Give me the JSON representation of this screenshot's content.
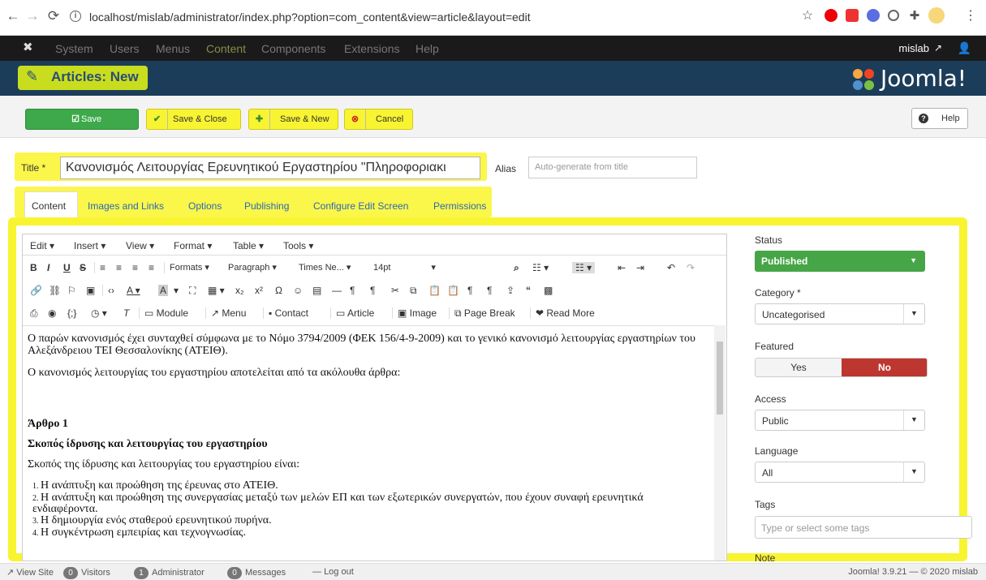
{
  "browser": {
    "url": "localhost/mislab/administrator/index.php?option=com_content&view=article&layout=edit"
  },
  "topmenu": {
    "items": [
      "System",
      "Users",
      "Menus",
      "Content",
      "Components",
      "Extensions",
      "Help"
    ],
    "user": "mislab"
  },
  "header": {
    "title": "Articles: New",
    "brand": "Joomla!"
  },
  "toolbar": {
    "save": "Save",
    "save_close": "Save & Close",
    "save_new": "Save & New",
    "cancel": "Cancel",
    "help": "Help"
  },
  "form": {
    "title_label": "Title *",
    "title_value": "Κανονισμός Λειτουργίας Ερευνητικού Εργαστηρίου \"Πληροφοριακι",
    "alias_label": "Alias",
    "alias_placeholder": "Auto-generate from title"
  },
  "tabs": [
    "Content",
    "Images and Links",
    "Options",
    "Publishing",
    "Configure Edit Screen",
    "Permissions"
  ],
  "editor": {
    "menus": [
      "Edit ▾",
      "Insert ▾",
      "View ▾",
      "Format ▾",
      "Table ▾",
      "Tools ▾"
    ],
    "formats": "Formats ▾",
    "paragraph": "Paragraph",
    "font": "Times Ne...",
    "size": "14pt",
    "row3": {
      "module": "Module",
      "menu": "Menu",
      "contact": "Contact",
      "article": "Article",
      "image": "Image",
      "pagebreak": "Page Break",
      "readmore": "Read More"
    },
    "content": {
      "p1": "Ο παρών κανονισμός έχει συνταχθεί σύμφωνα με το Νόμο 3794/2009 (ΦΕΚ 156/4-9-2009) και το γενικό κανονισμό λειτουργίας εργαστηρίων του Αλεξάνδρειου ΤΕΙ Θεσσαλονίκης (ΑΤΕΙΘ).",
      "p2": "Ο κανονισμός λειτουργίας του εργαστηρίου αποτελείται από τα ακόλουθα άρθρα:",
      "h1": "Άρθρο 1",
      "h2": "Σκοπός ίδρυσης και λειτουργίας του εργαστηρίου",
      "p3": "Σκοπός της ίδρυσης και λειτουργίας του εργαστηρίου είναι:",
      "list": [
        "Η ανάπτυξη και προώθηση της έρευνας στο ΑΤΕΙΘ.",
        "Η ανάπτυξη και προώθηση της συνεργασίας μεταξύ των μελών ΕΠ και των εξωτερικών συνεργατών, που έχουν συναφή ερευνητικά ενδιαφέροντα.",
        "Η δημιουργία ενός σταθερού ερευνητικού πυρήνα.",
        "Η συγκέντρωση εμπειρίας και τεχνογνωσίας."
      ]
    }
  },
  "sidebar": {
    "status_label": "Status",
    "status_value": "Published",
    "category_label": "Category *",
    "category_value": "Uncategorised",
    "featured_label": "Featured",
    "featured_yes": "Yes",
    "featured_no": "No",
    "access_label": "Access",
    "access_value": "Public",
    "language_label": "Language",
    "language_value": "All",
    "tags_label": "Tags",
    "tags_placeholder": "Type or select some tags",
    "note_label": "Note"
  },
  "statusbar": {
    "view_site": "View Site",
    "visitors_count": "0",
    "visitors": "Visitors",
    "admin_count": "1",
    "admin": "Administrator",
    "messages_count": "0",
    "messages": "Messages",
    "logout": "Log out",
    "version": "Joomla! 3.9.21 — © 2020 mislab"
  }
}
